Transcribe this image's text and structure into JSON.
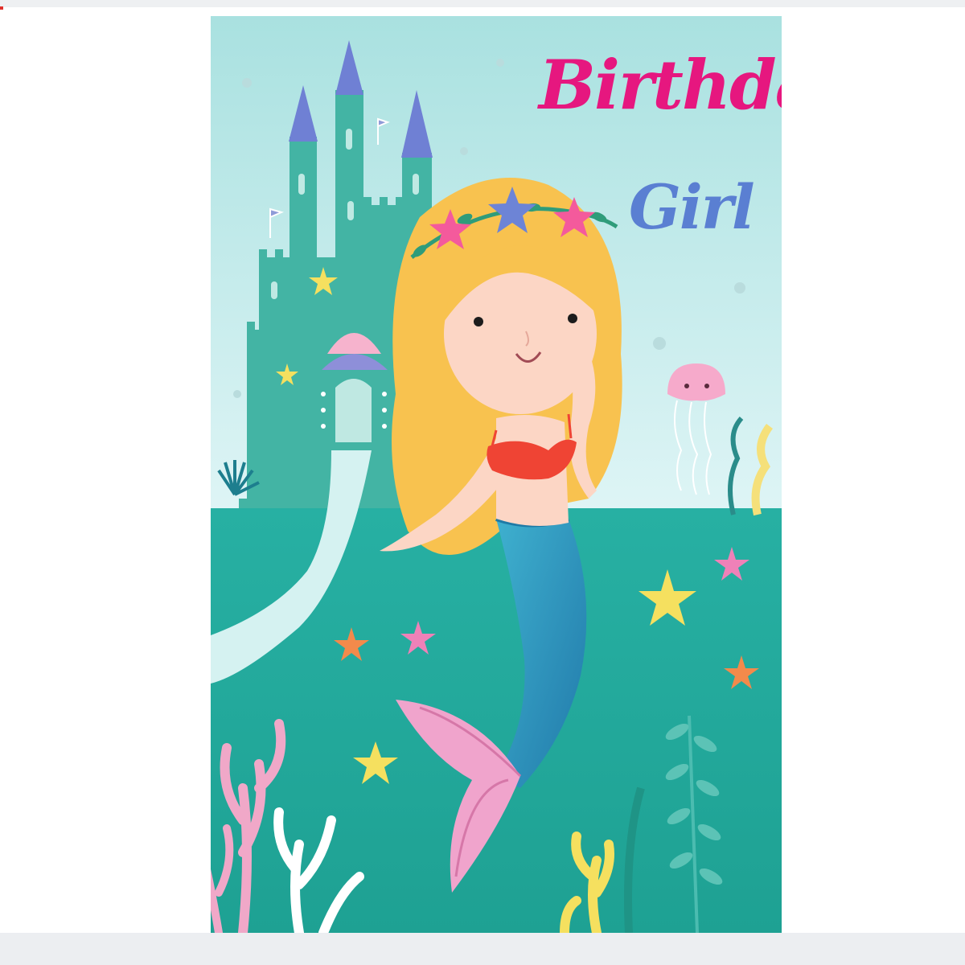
{
  "card": {
    "title_line_1": "Birthday",
    "title_line_2": "Girl"
  },
  "colors": {
    "sea_top": "#c8eeee",
    "sea_floor": "#22aa9d",
    "castle": "#43b4a4",
    "castle_roof": "#6f80d4",
    "hair": "#f8c24f",
    "tail": "#2a93b8",
    "fin": "#f0a4cc",
    "top": "#ef4434",
    "title_pink": "#e6177f",
    "title_blue": "#5a7fd2"
  },
  "icons": [
    "castle-icon",
    "mermaid-icon",
    "jellyfish-icon",
    "starfish-icon",
    "coral-icon",
    "seaweed-icon",
    "shell-icon"
  ]
}
